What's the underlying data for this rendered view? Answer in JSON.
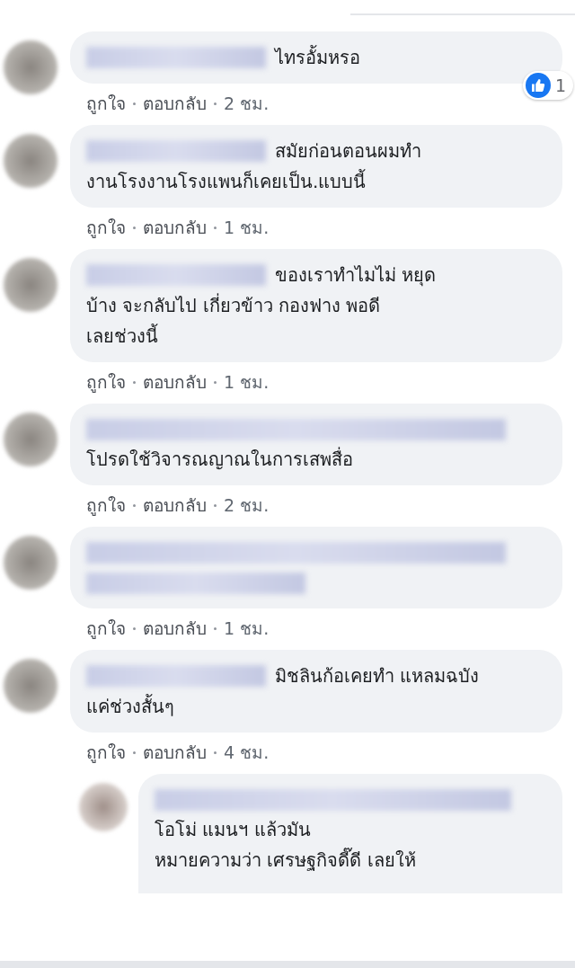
{
  "comments": [
    {
      "kind": "inline",
      "reply": false,
      "lines": [
        "ไทรอั้มหรอ"
      ],
      "reactions": "1",
      "actions": {
        "like": "ถูกใจ",
        "reply": "ตอบกลับ",
        "time": "2 ชม."
      }
    },
    {
      "kind": "inline",
      "reply": false,
      "lines": [
        "สมัยก่อนตอนผมทำ",
        "งานโรงงานโรงแพนก็เคยเป็น.แบบนี้"
      ],
      "actions": {
        "like": "ถูกใจ",
        "reply": "ตอบกลับ",
        "time": "1 ชม."
      }
    },
    {
      "kind": "inline",
      "reply": false,
      "lines": [
        "ของเราทำไมไม่ หยุด",
        "บ้าง จะกลับไป เกี่ยวข้าว กองฟาง พอดี",
        "เลยช่วงนี้"
      ],
      "actions": {
        "like": "ถูกใจ",
        "reply": "ตอบกลับ",
        "time": "1 ชม."
      }
    },
    {
      "kind": "block",
      "reply": false,
      "lines": [
        "โปรดใช้วิจารณญาณในการเสพสื่อ"
      ],
      "actions": {
        "like": "ถูกใจ",
        "reply": "ตอบกลับ",
        "time": "2 ชม."
      }
    },
    {
      "kind": "block",
      "reply": false,
      "actions": {
        "like": "ถูกใจ",
        "reply": "ตอบกลับ",
        "time": "1 ชม."
      }
    },
    {
      "kind": "inline",
      "reply": false,
      "lines": [
        "มิชลินก้อเคยทำ แหลมฉบัง",
        "แค่ช่วงสั้นๆ"
      ],
      "actions": {
        "like": "ถูกใจ",
        "reply": "ตอบกลับ",
        "time": "4 ชม."
      }
    },
    {
      "kind": "block",
      "reply": true,
      "lines": [
        "โอโม่ แมนฯ แล้วมัน",
        "หมายความว่า เศรษฐกิจดี๊ดี เลยให้"
      ]
    }
  ]
}
